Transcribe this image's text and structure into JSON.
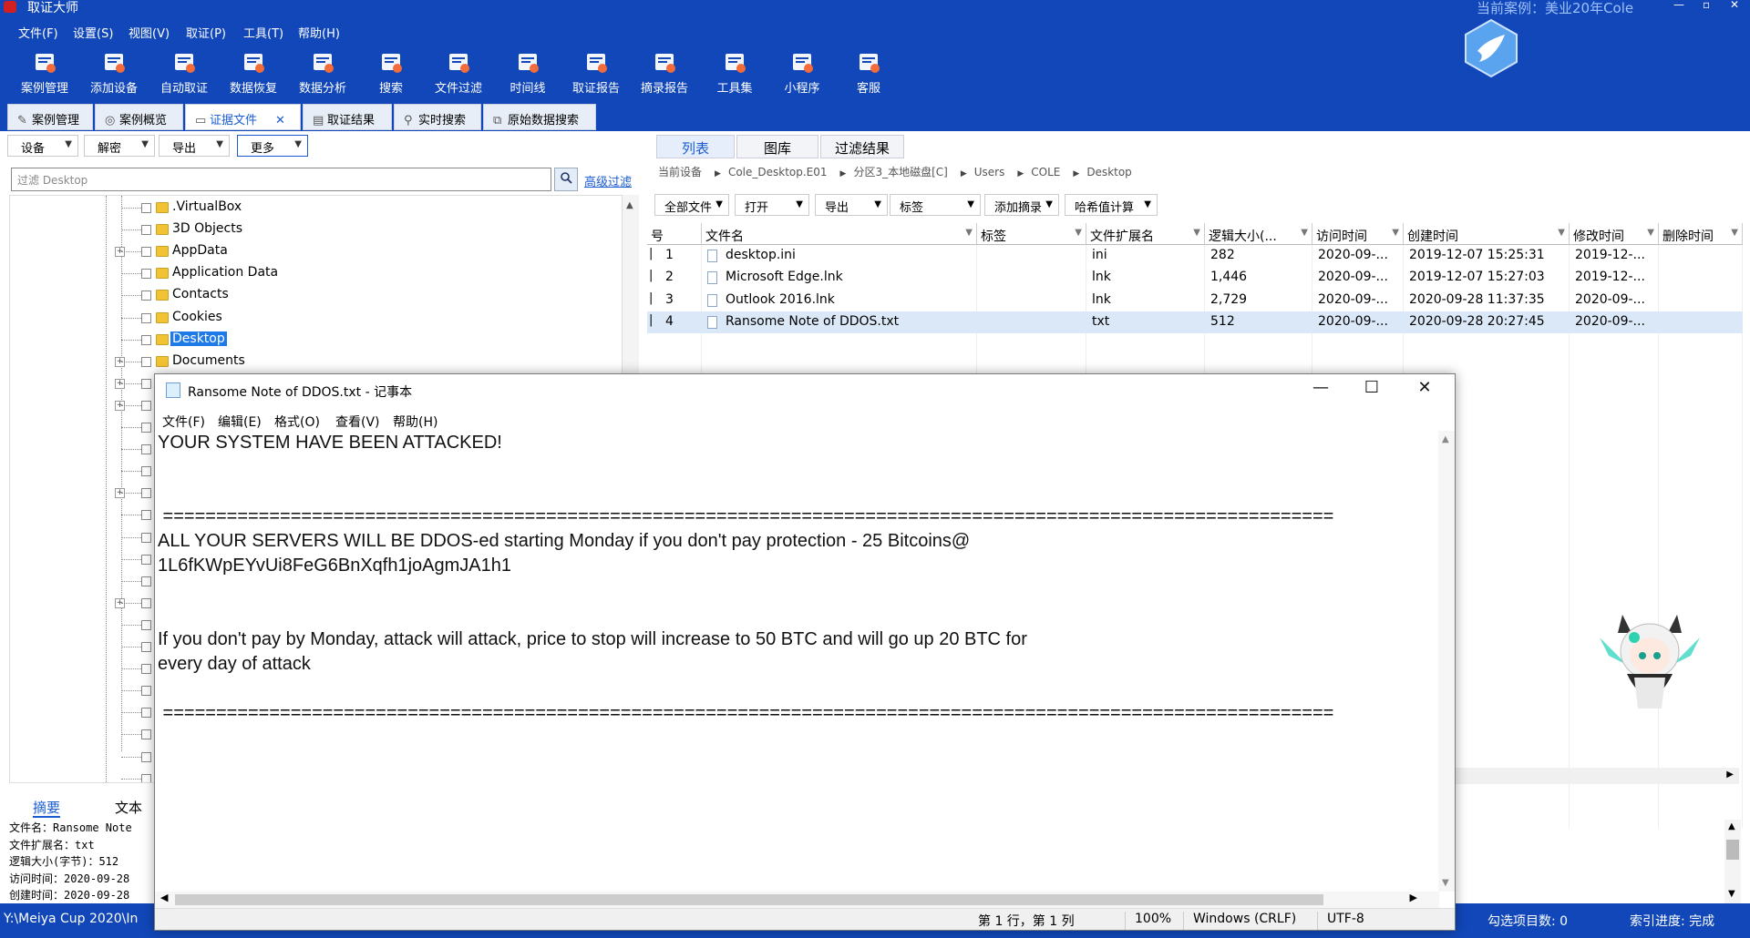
{
  "app": {
    "title": "取证大师",
    "current_case": "当前案例：美业20年Cole"
  },
  "menubar": [
    "文件(F)",
    "设置(S)",
    "视图(V)",
    "取证(P)",
    "工具(T)",
    "帮助(H)"
  ],
  "toolbar": [
    {
      "label": "案例管理",
      "icon": "case-management-icon"
    },
    {
      "label": "添加设备",
      "icon": "add-device-icon"
    },
    {
      "label": "自动取证",
      "icon": "auto-forensics-icon"
    },
    {
      "label": "数据恢复",
      "icon": "data-recovery-icon"
    },
    {
      "label": "数据分析",
      "icon": "data-analysis-icon"
    },
    {
      "label": "搜索",
      "icon": "search-icon"
    },
    {
      "label": "文件过滤",
      "icon": "file-filter-icon"
    },
    {
      "label": "时间线",
      "icon": "timeline-icon"
    },
    {
      "label": "取证报告",
      "icon": "report-icon"
    },
    {
      "label": "摘录报告",
      "icon": "excerpt-report-icon"
    },
    {
      "label": "工具集",
      "icon": "toolset-icon"
    },
    {
      "label": "小程序",
      "icon": "miniprogram-icon"
    },
    {
      "label": "客服",
      "icon": "customer-service-icon"
    }
  ],
  "tabs": [
    {
      "label": "案例管理",
      "icon": "✎"
    },
    {
      "label": "案例概览",
      "icon": "◎"
    },
    {
      "label": "证据文件",
      "icon": "▭",
      "active": true
    },
    {
      "label": "取证结果",
      "icon": "▤"
    },
    {
      "label": "实时搜索",
      "icon": "⚲"
    },
    {
      "label": "原始数据搜索",
      "icon": "⧉"
    }
  ],
  "left": {
    "dropdowns": [
      "设备",
      "解密",
      "导出",
      "更多"
    ],
    "filter_placeholder": "过滤 Desktop",
    "advanced_filter": "高级过滤",
    "tree": [
      {
        "label": ".VirtualBox",
        "expandable": false
      },
      {
        "label": "3D Objects",
        "expandable": false
      },
      {
        "label": "AppData",
        "expandable": true
      },
      {
        "label": "Application Data",
        "expandable": false
      },
      {
        "label": "Contacts",
        "expandable": false
      },
      {
        "label": "Cookies",
        "expandable": false
      },
      {
        "label": "Desktop",
        "expandable": false,
        "selected": true
      },
      {
        "label": "Documents",
        "expandable": true
      }
    ],
    "summary_tabs": [
      "摘要",
      "文本"
    ],
    "summary_lines": [
      "文件名：Ransome Note",
      "文件扩展名：txt",
      "逻辑大小(字节)：512",
      "访问时间：2020-09-28",
      "创建时间：2020-09-28"
    ]
  },
  "right": {
    "view_tabs": [
      "列表",
      "图库",
      "过滤结果"
    ],
    "breadcrumb": [
      "当前设备",
      "Cole_Desktop.E01",
      "分区3_本地磁盘[C]",
      "Users",
      "COLE",
      "Desktop"
    ],
    "dropdowns": [
      "全部文件",
      "打开",
      "导出",
      "标签",
      "添加摘录",
      "哈希值计算"
    ],
    "columns": [
      "号",
      "文件名",
      "标签",
      "文件扩展名",
      "逻辑大小(...",
      "访问时间",
      "创建时间",
      "修改时间",
      "删除时间"
    ],
    "rows": [
      {
        "no": "1",
        "name": "desktop.ini",
        "tag": "",
        "ext": "ini",
        "size": "282",
        "accessed": "2020-09-...",
        "created": "2019-12-07 15:25:31",
        "modified": "2019-12-...",
        "deleted": ""
      },
      {
        "no": "2",
        "name": "Microsoft Edge.lnk",
        "tag": "",
        "ext": "lnk",
        "size": "1,446",
        "accessed": "2020-09-...",
        "created": "2019-12-07 15:27:03",
        "modified": "2019-12-...",
        "deleted": ""
      },
      {
        "no": "3",
        "name": "Outlook 2016.lnk",
        "tag": "",
        "ext": "lnk",
        "size": "2,729",
        "accessed": "2020-09-...",
        "created": "2020-09-28 11:37:35",
        "modified": "2020-09-...",
        "deleted": ""
      },
      {
        "no": "4",
        "name": "Ransome Note of DDOS.txt",
        "tag": "",
        "ext": "txt",
        "size": "512",
        "accessed": "2020-09-...",
        "created": "2020-09-28 20:27:45",
        "modified": "2020-09-...",
        "deleted": "",
        "selected": true
      }
    ]
  },
  "statusbar": {
    "path": "Y:\\Meiya Cup 2020\\In",
    "checked": "勾选项目数: 0",
    "index": "索引进度: 完成"
  },
  "notepad": {
    "title": "Ransome Note of DDOS.txt - 记事本",
    "menu": [
      "文件(F)",
      "编辑(E)",
      "格式(O)",
      "查看(V)",
      "帮助(H)"
    ],
    "content": "YOUR SYSTEM HAVE BEEN ATTACKED!\n\n\n ==============================================================================================================\nALL YOUR SERVERS WILL BE DDOS-ed starting Monday if you don't pay protection - 25 Bitcoins@\n1L6fKWpEYvUi8FeG6BnXqfh1joAgmJA1h1\n\n\nIf you don't pay by Monday, attack will attack, price to stop will increase to 50 BTC and will go up 20 BTC for\nevery day of attack\n\n ==============================================================================================================",
    "status": {
      "position": "第 1 行，第 1 列",
      "zoom": "100%",
      "eol": "Windows (CRLF)",
      "encoding": "UTF-8"
    }
  }
}
